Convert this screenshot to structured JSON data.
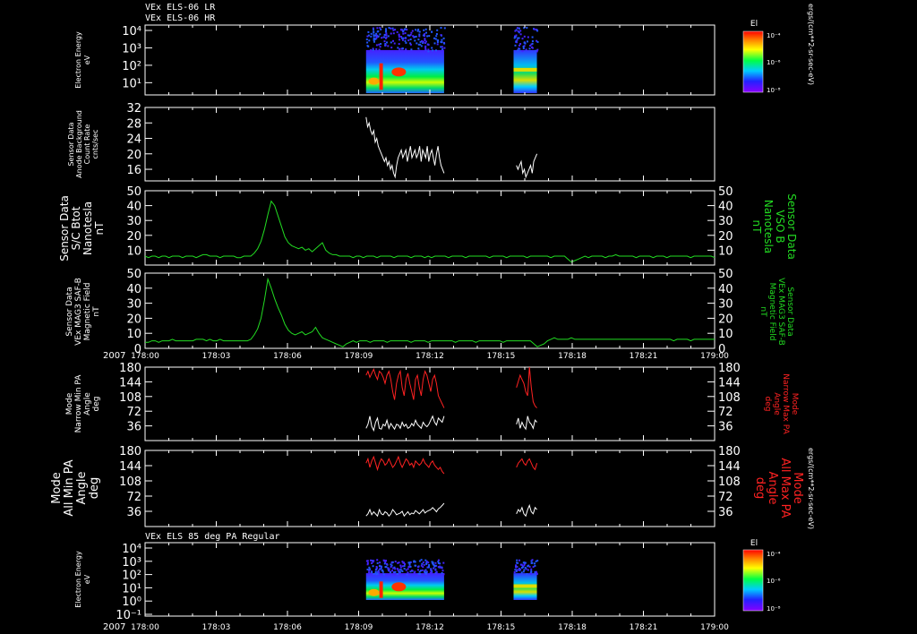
{
  "colors": {
    "background": "#000000",
    "frame": "#ffffff",
    "green": "#22dd22",
    "red": "#ff2222",
    "white": "#ffffff",
    "legend_green": "#22dd22",
    "legend_red": "#ff2222"
  },
  "header": {
    "line1": "VEx ELS-06 LR",
    "line2": "VEx ELS-06 HR"
  },
  "time_axis": {
    "year": "2007",
    "ticks": [
      "178:00",
      "178:03",
      "178:06",
      "178:09",
      "178:12",
      "178:15",
      "178:18",
      "178:21",
      "179:00"
    ]
  },
  "colorbar": {
    "title": "El",
    "unit": "ergs/(cm**2-sr-sec-eV)",
    "top_label": "10⁻⁴",
    "mid_label": "10⁻⁶",
    "bottom_label": "10⁻⁸"
  },
  "chart_data": [
    {
      "type": "heatmap",
      "id": "p1",
      "ylabel": [
        "Electron Energy",
        "eV"
      ],
      "y_tick_labels": [
        "10⁴",
        "10³",
        "10²",
        "10¹"
      ],
      "log_scale": true,
      "blocks": [
        {
          "t_start": 0.388,
          "t_end": 0.525,
          "label": "block1"
        },
        {
          "t_start": 0.647,
          "t_end": 0.688,
          "label": "block2"
        }
      ]
    },
    {
      "type": "line",
      "id": "p2",
      "ylabel": [
        "Sensor Data",
        "Anode Background",
        "Count Rate",
        "cnts/sec"
      ],
      "y_ticks": [
        16,
        20,
        24,
        28,
        32
      ],
      "ylim": [
        13,
        32
      ],
      "series": [
        {
          "color": "white",
          "segments": [
            {
              "t_start": 0.388,
              "t_end": 0.525,
              "values": [
                29.5,
                27,
                28,
                26,
                25,
                26,
                23,
                24,
                22,
                21,
                20,
                19,
                18,
                19,
                17,
                18,
                16,
                17,
                15,
                14,
                17,
                19,
                20,
                21,
                19,
                20,
                21,
                18,
                20,
                22,
                19,
                20,
                21,
                19,
                20,
                22,
                18,
                21,
                20,
                19,
                22,
                18,
                20,
                21,
                19,
                17,
                20,
                22,
                19,
                17,
                16,
                15
              ]
            },
            {
              "t_start": 0.652,
              "t_end": 0.688,
              "values": [
                17,
                16,
                17,
                18,
                15,
                16,
                14,
                15,
                16,
                17,
                15,
                18,
                19,
                20
              ]
            }
          ]
        }
      ]
    },
    {
      "type": "line",
      "id": "p3",
      "ylabel": [
        "Sensor Data",
        "S/C Btot",
        "Nanotesla",
        "nT"
      ],
      "ylabel_right": [
        "Sensor Data",
        "VSO B",
        "Nanotesla",
        "nT"
      ],
      "y_ticks": [
        10,
        20,
        30,
        40,
        50
      ],
      "ylim": [
        0,
        50
      ],
      "series": [
        {
          "color": "green",
          "values": [
            6,
            5,
            6,
            6,
            5,
            6,
            6,
            5,
            6,
            6,
            6,
            5,
            6,
            6,
            6,
            5,
            6,
            7,
            7,
            6,
            6,
            6,
            5,
            6,
            6,
            6,
            6,
            5,
            5,
            6,
            6,
            6,
            8,
            11,
            16,
            24,
            34,
            43,
            40,
            33,
            26,
            19,
            15,
            13,
            12,
            11,
            12,
            10,
            11,
            9,
            11,
            13,
            15,
            10,
            8,
            7,
            7,
            6,
            6,
            6,
            6,
            5,
            6,
            6,
            5,
            6,
            6,
            6,
            5,
            6,
            6,
            6,
            6,
            5,
            6,
            6,
            6,
            6,
            5,
            6,
            6,
            6,
            5,
            6,
            5,
            6,
            6,
            6,
            6,
            5,
            6,
            6,
            6,
            6,
            5,
            6,
            6,
            6,
            6,
            6,
            6,
            5,
            6,
            6,
            6,
            6,
            5,
            6,
            6,
            6,
            6,
            6,
            5,
            6,
            6,
            6,
            6,
            6,
            6,
            5,
            6,
            6,
            6,
            6,
            4,
            2,
            3,
            4,
            5,
            6,
            5,
            6,
            6,
            6,
            6,
            5,
            6,
            6,
            7,
            6,
            6,
            6,
            6,
            6,
            5,
            6,
            6,
            6,
            6,
            5,
            6,
            6,
            6,
            5,
            6,
            6,
            6,
            6,
            6,
            6,
            5,
            6,
            6,
            6,
            6,
            6,
            6,
            5
          ]
        }
      ]
    },
    {
      "type": "line",
      "id": "p4",
      "ylabel": [
        "Sensor Data",
        "VEx MAG3 SAF-B",
        "Magnetic Field",
        "nT"
      ],
      "ylabel_right": [
        "Sensor Data",
        "VEx MAG3 SAF-B",
        "Magnetic Field",
        "nT"
      ],
      "y_ticks": [
        0,
        10,
        20,
        30,
        40,
        50
      ],
      "ylim": [
        0,
        50
      ],
      "series": [
        {
          "color": "green",
          "values": [
            4,
            4,
            5,
            5,
            4,
            5,
            5,
            5,
            6,
            5,
            5,
            5,
            5,
            5,
            5,
            6,
            6,
            6,
            5,
            6,
            5,
            5,
            6,
            5,
            5,
            5,
            5,
            5,
            5,
            5,
            5,
            6,
            9,
            13,
            20,
            32,
            46,
            40,
            33,
            27,
            22,
            16,
            12,
            10,
            9,
            10,
            11,
            9,
            10,
            11,
            14,
            10,
            7,
            6,
            5,
            4,
            3,
            2,
            1,
            3,
            4,
            5,
            4,
            5,
            5,
            5,
            4,
            5,
            5,
            5,
            5,
            4,
            5,
            5,
            5,
            5,
            5,
            5,
            4,
            5,
            5,
            5,
            5,
            4,
            5,
            5,
            5,
            5,
            5,
            5,
            5,
            4,
            5,
            5,
            5,
            5,
            5,
            4,
            5,
            5,
            5,
            5,
            5,
            5,
            5,
            4,
            5,
            5,
            5,
            5,
            5,
            5,
            5,
            5,
            3,
            1,
            2,
            3,
            5,
            6,
            7,
            6,
            6,
            6,
            6,
            7,
            6,
            6,
            6,
            6,
            6,
            6,
            6,
            6,
            6,
            6,
            6,
            6,
            6,
            6,
            6,
            6,
            6,
            6,
            6,
            6,
            6,
            6,
            6,
            6,
            6,
            6,
            6,
            6,
            6,
            5,
            6,
            6,
            6,
            6,
            5,
            6,
            6,
            6,
            6,
            6,
            6,
            6
          ]
        }
      ]
    },
    {
      "type": "line",
      "id": "p5",
      "ylabel": [
        "Mode",
        "Narrow Min PA",
        "Angle",
        "deg"
      ],
      "ylabel_right": [
        "Mode",
        "Narrow Max PA",
        "Angle",
        "deg"
      ],
      "y_ticks": [
        36,
        72,
        108,
        144,
        180
      ],
      "ylim": [
        0,
        180
      ],
      "series": [
        {
          "color": "red",
          "segments": [
            {
              "t_start": 0.388,
              "t_end": 0.525,
              "values": [
                160,
                170,
                155,
                165,
                175,
                160,
                150,
                170,
                165,
                155,
                140,
                160,
                170,
                150,
                120,
                100,
                140,
                160,
                170,
                130,
                110,
                150,
                165,
                140,
                120,
                100,
                150,
                160,
                130,
                110,
                150,
                170,
                160,
                140,
                120,
                150,
                160,
                140,
                110,
                100,
                90,
                80
              ]
            },
            {
              "t_start": 0.652,
              "t_end": 0.688,
              "values": [
                130,
                145,
                160,
                150,
                140,
                120,
                110,
                180,
                130,
                95,
                85,
                80
              ]
            }
          ]
        },
        {
          "color": "white",
          "segments": [
            {
              "t_start": 0.388,
              "t_end": 0.525,
              "values": [
                30,
                40,
                60,
                35,
                25,
                45,
                55,
                30,
                28,
                40,
                36,
                50,
                30,
                42,
                35,
                28,
                40,
                38,
                30,
                45,
                35,
                40,
                30,
                33,
                42,
                36,
                50,
                40,
                35,
                30,
                45,
                38,
                34,
                40,
                50,
                60,
                45,
                38,
                55,
                50,
                45,
                60
              ]
            },
            {
              "t_start": 0.652,
              "t_end": 0.688,
              "values": [
                40,
                55,
                30,
                45,
                35,
                28,
                60,
                45,
                40,
                30,
                50,
                45
              ]
            }
          ]
        }
      ]
    },
    {
      "type": "line",
      "id": "p6",
      "ylabel": [
        "Mode",
        "All Min PA",
        "Angle",
        "deg"
      ],
      "ylabel_right": [
        "Mode",
        "All Max PA",
        "Angle",
        "deg"
      ],
      "y_ticks": [
        36,
        72,
        108,
        144,
        180
      ],
      "ylim": [
        0,
        180
      ],
      "series": [
        {
          "color": "red",
          "segments": [
            {
              "t_start": 0.388,
              "t_end": 0.525,
              "values": [
                150,
                160,
                140,
                155,
                165,
                150,
                135,
                150,
                160,
                155,
                145,
                150,
                160,
                150,
                140,
                145,
                155,
                165,
                150,
                140,
                150,
                160,
                155,
                145,
                150,
                140,
                155,
                150,
                145,
                150,
                160,
                150,
                145,
                140,
                150,
                155,
                145,
                140,
                135,
                140,
                130,
                125
              ]
            },
            {
              "t_start": 0.652,
              "t_end": 0.688,
              "values": [
                140,
                150,
                155,
                160,
                150,
                145,
                155,
                160,
                150,
                140,
                135,
                150
              ]
            }
          ]
        },
        {
          "color": "white",
          "segments": [
            {
              "t_start": 0.388,
              "t_end": 0.525,
              "values": [
                25,
                30,
                40,
                28,
                35,
                30,
                25,
                40,
                30,
                28,
                35,
                32,
                25,
                30,
                40,
                35,
                28,
                30,
                32,
                36,
                25,
                30,
                35,
                28,
                32,
                30,
                38,
                34,
                30,
                35,
                40,
                32,
                36,
                38,
                40,
                45,
                40,
                35,
                42,
                45,
                50,
                55
              ]
            },
            {
              "t_start": 0.652,
              "t_end": 0.688,
              "values": [
                30,
                40,
                35,
                45,
                30,
                25,
                40,
                50,
                35,
                30,
                45,
                40
              ]
            }
          ]
        }
      ]
    },
    {
      "type": "heatmap",
      "id": "p7",
      "title": "VEx ELS 85 deg PA Regular",
      "ylabel": [
        "Electron Energy",
        "eV"
      ],
      "y_tick_labels": [
        "10⁴",
        "10³",
        "10²",
        "10¹",
        "10⁰",
        "10⁻¹"
      ],
      "log_scale": true,
      "blocks": [
        {
          "t_start": 0.388,
          "t_end": 0.525,
          "label": "block1"
        },
        {
          "t_start": 0.647,
          "t_end": 0.688,
          "label": "block2"
        }
      ]
    }
  ]
}
